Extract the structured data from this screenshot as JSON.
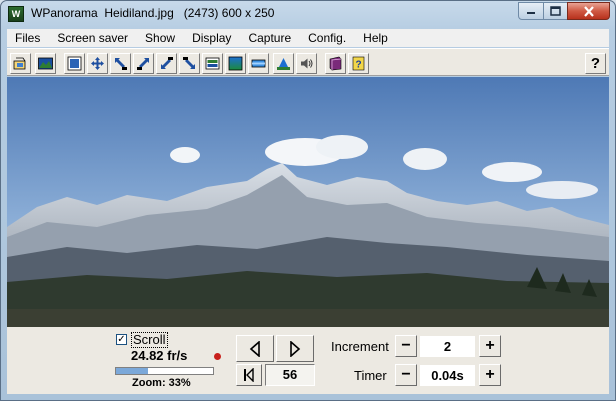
{
  "window": {
    "title": "WPanorama  Heidiland.jpg   (2473) 600 x 250",
    "icon_name": "wpanorama-app-icon"
  },
  "menu": [
    "Files",
    "Screen saver",
    "Show",
    "Display",
    "Capture",
    "Config.",
    "Help"
  ],
  "toolbar": {
    "buttons": [
      "open-file-icon",
      "image-icon",
      "fit-window-icon",
      "move-icon",
      "zoom-out-arrow-icon",
      "arrow-up-right-icon",
      "arrow-down-left-icon",
      "arrow-down-right-icon",
      "frame-icon",
      "gradient-icon",
      "band-icon",
      "viewer-icon",
      "sound-icon",
      "book-icon",
      "help-book-icon"
    ],
    "help_label": "?"
  },
  "controls": {
    "scroll_checked": true,
    "scroll_check_mark": "✓",
    "scroll_label": "Scroll",
    "fps": "24.82 fr/s",
    "zoom_label": "Zoom: 33%",
    "zoom_fraction": 0.33,
    "frame_counter": "56",
    "increment_label": "Increment",
    "increment_value": "2",
    "timer_label": "Timer",
    "timer_value": "0.04s",
    "minus": "−",
    "plus": "+"
  },
  "colors": {
    "sky": "#6a8fbd",
    "accent": "#c8201c"
  }
}
